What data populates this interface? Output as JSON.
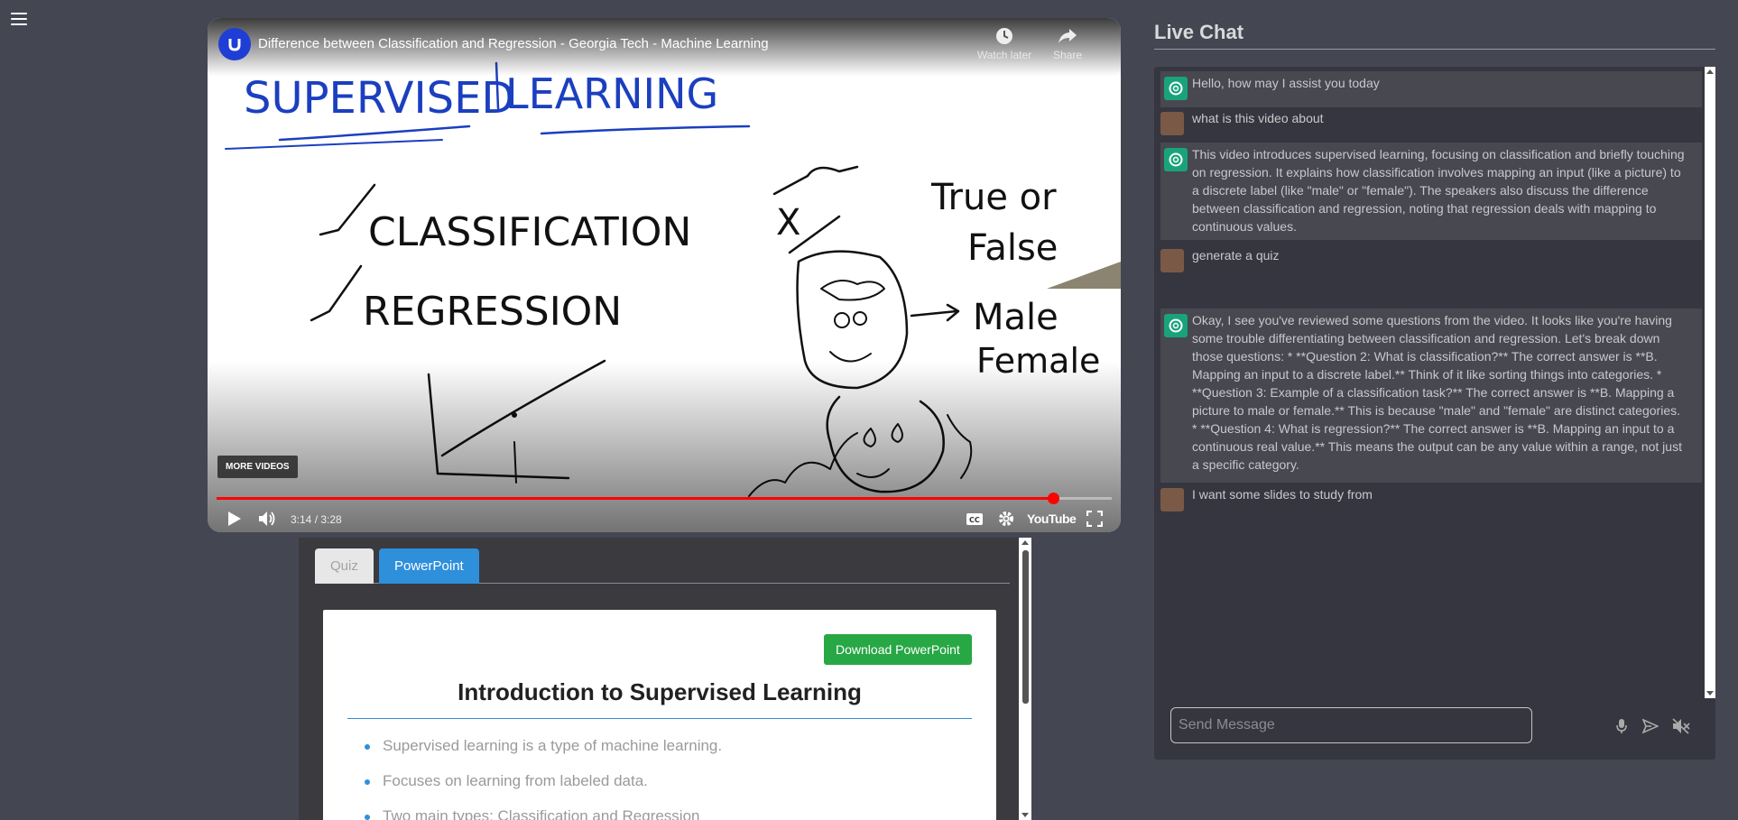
{
  "video": {
    "title": "Difference between Classification and Regression - Georgia Tech - Machine Learning",
    "watch_later": "Watch later",
    "share": "Share",
    "more_videos": "MORE VIDEOS",
    "time": "3:14 / 3:28",
    "progress": 0.934,
    "youtube_label": "YouTube",
    "whiteboard": {
      "heading_left": "SUPERVISED",
      "heading_right": "LEARNING",
      "item1": "CLASSIFICATION",
      "item2": "REGRESSION",
      "true_or": "True or",
      "false": "False",
      "male": "Male",
      "female": "Female",
      "x_label": "X"
    }
  },
  "tabs": [
    {
      "label": "Quiz",
      "active": false
    },
    {
      "label": "PowerPoint",
      "active": true
    }
  ],
  "slide": {
    "download_label": "Download PowerPoint",
    "title": "Introduction to Supervised Learning",
    "bullets": [
      "Supervised learning is a type of machine learning.",
      "Focuses on learning from labeled data.",
      "Two main types: Classification and Regression"
    ]
  },
  "chat": {
    "heading": "Live Chat",
    "placeholder": "Send Message",
    "messages": [
      {
        "role": "bot",
        "text": "Hello, how may I assist you today"
      },
      {
        "role": "user",
        "text": "what is this video about"
      },
      {
        "role": "bot",
        "text": "This video introduces supervised learning, focusing on classification and briefly touching on regression. It explains how classification involves mapping an input (like a picture) to a discrete label (like \"male\" or \"female\"). The speakers also discuss the difference between classification and regression, noting that regression deals with mapping to continuous values."
      },
      {
        "role": "user",
        "text": "generate a quiz"
      },
      {
        "role": "bot",
        "text": "Okay, I see you've reviewed some questions from the video. It looks like you're having some trouble differentiating between classification and regression. Let's break down those questions: * **Question 2: What is classification?** The correct answer is **B. Mapping an input to a discrete label.** Think of it like sorting things into categories. * **Question 3: Example of a classification task?** The correct answer is **B. Mapping a picture to male or female.** This is because \"male\" and \"female\" are distinct categories. * **Question 4: What is regression?** The correct answer is **B. Mapping an input to a continuous real value.** This means the output can be any value within a range, not just a specific category."
      },
      {
        "role": "user",
        "text": "I want some slides to study from"
      }
    ]
  },
  "colors": {
    "page_bg": "#444652",
    "accent_blue": "#2e8fdb",
    "download_green": "#28a745",
    "progress_red": "#ff0000",
    "chat_bot_bg": "#474850",
    "chat_panel_bg": "#363640"
  },
  "icons": {
    "menu": "hamburger-icon",
    "watch_later": "clock-icon",
    "share": "share-arrow-icon",
    "play": "play-icon",
    "volume": "volume-icon",
    "captions": "cc-icon",
    "settings": "gear-icon",
    "fullscreen": "fullscreen-icon",
    "mic": "microphone-icon",
    "send": "send-icon",
    "mute": "speaker-muted-icon",
    "bot_avatar": "openai-logo-icon"
  }
}
